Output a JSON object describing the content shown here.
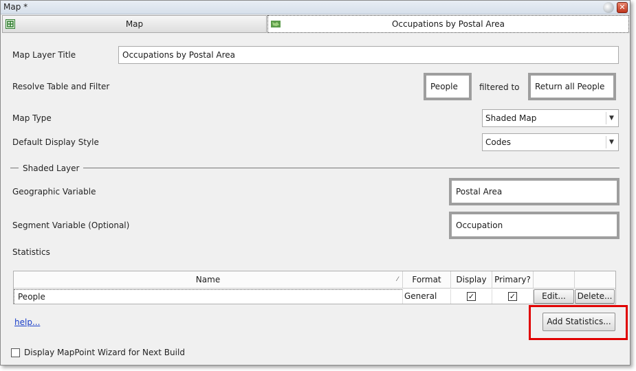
{
  "window": {
    "title": "Map *"
  },
  "tabs": [
    {
      "label": "Map"
    },
    {
      "label": "Occupations by Postal Area"
    }
  ],
  "form": {
    "layer_title_label": "Map Layer Title",
    "layer_title_value": "Occupations by Postal Area",
    "resolve_label": "Resolve Table and Filter",
    "resolve_table": "People",
    "filtered_to": "filtered to",
    "filter_value": "Return all People",
    "map_type_label": "Map Type",
    "map_type_value": "Shaded Map",
    "display_style_label": "Default Display Style",
    "display_style_value": "Codes",
    "shaded_layer_group": "Shaded Layer",
    "geo_var_label": "Geographic Variable",
    "geo_var_value": "Postal Area",
    "segment_var_label": "Segment Variable (Optional)",
    "segment_var_value": "Occupation",
    "statistics_label": "Statistics"
  },
  "stats_table": {
    "headers": {
      "name": "Name",
      "format": "Format",
      "display": "Display",
      "primary": "Primary?"
    },
    "rows": [
      {
        "name": "People",
        "format": "General",
        "display": true,
        "primary": true,
        "edit": "Edit...",
        "delete": "Delete..."
      }
    ]
  },
  "footer": {
    "help": "help...",
    "add_statistics": "Add Statistics...",
    "wizard_checkbox": "Display MapPoint Wizard for Next Build"
  },
  "colors": {
    "highlight": "#e00000",
    "link": "#1a3fc9",
    "frame": "#9e9e9e"
  }
}
